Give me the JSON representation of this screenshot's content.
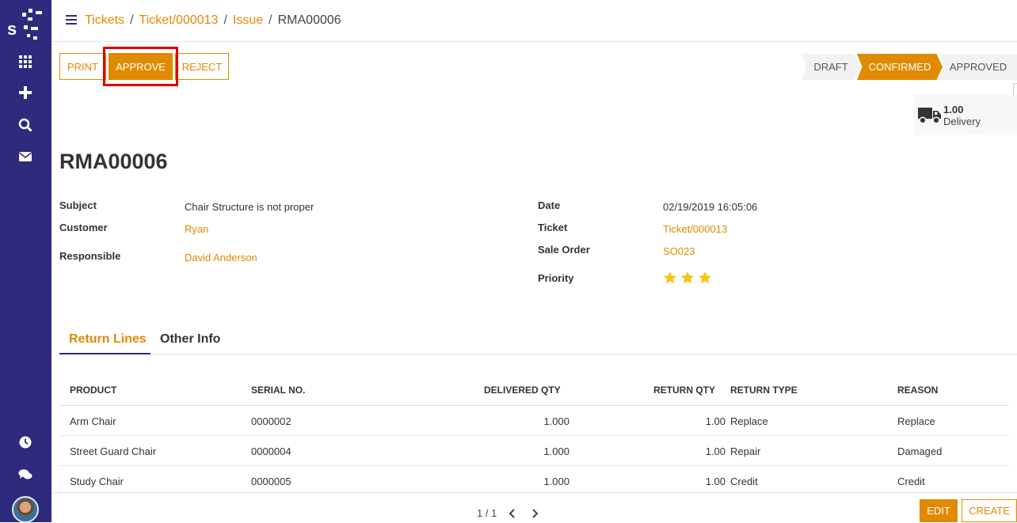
{
  "breadcrumb": [
    "Tickets",
    "Ticket/000013",
    "Issue",
    "RMA00006"
  ],
  "buttons": {
    "print": "PRINT",
    "approve": "APPROVE",
    "reject": "REJECT"
  },
  "status": {
    "draft": "DRAFT",
    "confirmed": "CONFIRMED",
    "approved": "APPROVED",
    "current": "CONFIRMED"
  },
  "smart_button": {
    "value": "1.00",
    "label": "Delivery"
  },
  "record": {
    "title": "RMA00006",
    "subject_label": "Subject",
    "subject": "Chair Structure is not proper",
    "customer_label": "Customer",
    "customer": "Ryan",
    "responsible_label": "Responsible",
    "responsible": "David Anderson",
    "date_label": "Date",
    "date": "02/19/2019 16:05:06",
    "ticket_label": "Ticket",
    "ticket": "Ticket/000013",
    "sale_order_label": "Sale Order",
    "sale_order": "SO023",
    "priority_label": "Priority",
    "priority_stars": 3
  },
  "tabs": [
    "Return Lines",
    "Other Info"
  ],
  "table": {
    "headers": [
      "PRODUCT",
      "SERIAL NO.",
      "DELIVERED QTY",
      "RETURN QTY",
      "RETURN TYPE",
      "REASON"
    ],
    "rows": [
      [
        "Arm Chair",
        "0000002",
        "1.000",
        "1.00",
        "Replace",
        "Replace"
      ],
      [
        "Street Guard Chair",
        "0000004",
        "1.000",
        "1.00",
        "Repair",
        "Damaged"
      ],
      [
        "Study Chair",
        "0000005",
        "1.000",
        "1.00",
        "Credit",
        "Credit"
      ]
    ]
  },
  "pager": "1 / 1",
  "bottom_buttons": {
    "edit": "EDIT",
    "create": "CREATE"
  },
  "colors": {
    "brand": "#2e2a7d",
    "accent": "#e08a00",
    "star": "#f5c518",
    "highlight": "#e00000"
  },
  "icons": [
    "apps-icon",
    "plus-icon",
    "search-icon",
    "mail-icon",
    "clock-icon",
    "chat-icon",
    "truck-icon",
    "star-icon"
  ]
}
